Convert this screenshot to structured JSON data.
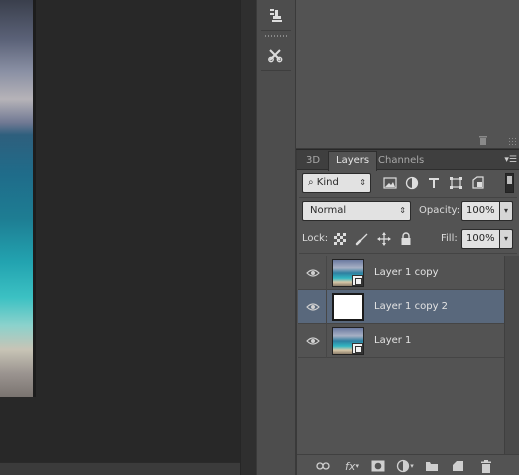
{
  "tabs": [
    {
      "label": "3D"
    },
    {
      "label": "Layers"
    },
    {
      "label": "Channels"
    }
  ],
  "filter": {
    "kind_label": "Kind"
  },
  "blend": {
    "mode": "Normal"
  },
  "opacity": {
    "label": "Opacity:",
    "value": "100%"
  },
  "lock": {
    "label": "Lock:"
  },
  "fill": {
    "label": "Fill:",
    "value": "100%"
  },
  "layers": [
    {
      "name": "Layer 1 copy",
      "thumb": "photo",
      "smart_object": true,
      "visible": true,
      "selected": false
    },
    {
      "name": "Layer 1 copy 2",
      "thumb": "white",
      "smart_object": false,
      "visible": true,
      "selected": true
    },
    {
      "name": "Layer 1",
      "thumb": "photo",
      "smart_object": true,
      "visible": true,
      "selected": false
    }
  ],
  "footer_icons": [
    "link-icon",
    "fx-icon",
    "mask-icon",
    "adjustment-icon",
    "folder-icon",
    "new-layer-icon",
    "trash-icon"
  ],
  "colors": {
    "selection": "#59687c",
    "panel": "#535353"
  }
}
